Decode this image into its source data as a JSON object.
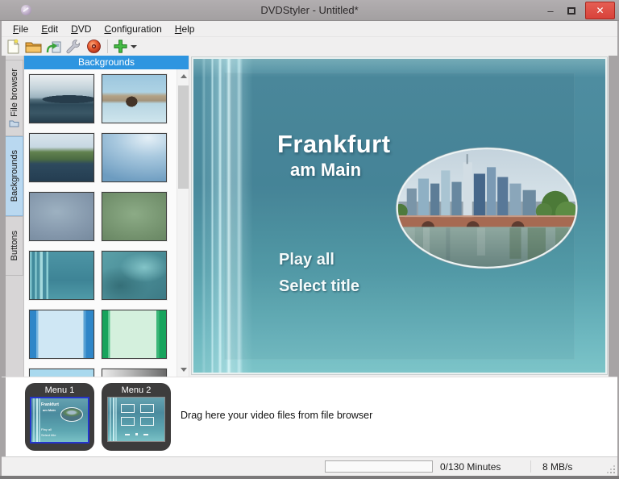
{
  "window": {
    "title": "DVDStyler - Untitled*",
    "minimize_glyph": "–",
    "close_glyph": "✕"
  },
  "menubar": {
    "items": [
      {
        "first": "F",
        "rest": "ile"
      },
      {
        "first": "E",
        "rest": "dit"
      },
      {
        "first": "D",
        "rest": "VD"
      },
      {
        "first": "C",
        "rest": "onfiguration"
      },
      {
        "first": "H",
        "rest": "elp"
      }
    ]
  },
  "toolbar": {
    "buttons": [
      {
        "name": "new-project-icon"
      },
      {
        "name": "open-project-folder-icon"
      },
      {
        "name": "save-project-icon"
      },
      {
        "name": "settings-wrench-icon"
      },
      {
        "name": "burn-dvd-icon"
      },
      {
        "name": "add-file-plus-icon"
      }
    ]
  },
  "sidebar": {
    "tabs": [
      {
        "label": "File browser"
      },
      {
        "label": "Backgrounds"
      },
      {
        "label": "Buttons"
      }
    ],
    "selected": "Backgrounds"
  },
  "backgrounds_panel": {
    "header": "Backgrounds",
    "thumbnails": [
      {
        "name": "sea-with-cloudy-sky"
      },
      {
        "name": "beach-with-ship"
      },
      {
        "name": "green-riverbank"
      },
      {
        "name": "blue-sky-gradient"
      },
      {
        "name": "grey-blue-clouds"
      },
      {
        "name": "green-meadow-blur"
      },
      {
        "name": "teal-with-vertical-stripes"
      },
      {
        "name": "underwater-teal-texture"
      },
      {
        "name": "light-blue-with-side-bars"
      },
      {
        "name": "light-green-with-side-bars"
      },
      {
        "name": "blue-horizontal-gradient"
      },
      {
        "name": "grey-horizontal-gradient"
      }
    ]
  },
  "preview": {
    "title_line1": "Frankfurt",
    "title_line2": "am Main",
    "button_play": "Play all",
    "button_select": "Select title"
  },
  "timeline": {
    "menu1_label": "Menu 1",
    "menu2_label": "Menu 2",
    "drop_hint": "Drag here your video files from file browser"
  },
  "statusbar": {
    "duration": "0/130 Minutes",
    "speed": "8 MB/s"
  },
  "colors": {
    "accent_blue": "#2E95E0",
    "close_red": "#D8423A",
    "preview_teal_top": "#49899C",
    "preview_teal_bottom": "#7CC4C8",
    "selection_blue": "#2434CC"
  }
}
